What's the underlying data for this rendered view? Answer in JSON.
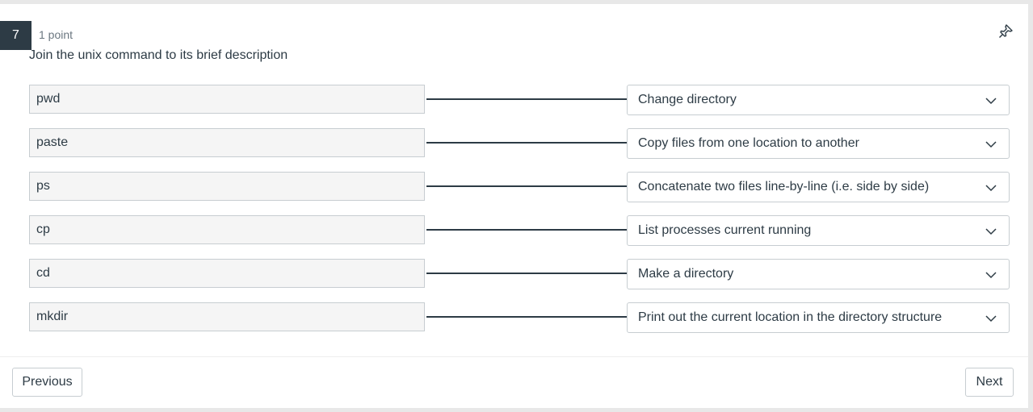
{
  "question": {
    "number": "7",
    "points": "1 point",
    "text": "Join the unix command to its brief description"
  },
  "pairs": [
    {
      "term": "pwd",
      "selected": "Change directory"
    },
    {
      "term": "paste",
      "selected": "Copy files from one location to another"
    },
    {
      "term": "ps",
      "selected": "Concatenate two files line-by-line (i.e. side by side)"
    },
    {
      "term": "cp",
      "selected": "List processes current running"
    },
    {
      "term": "cd",
      "selected": "Make a directory"
    },
    {
      "term": "mkdir",
      "selected": "Print out the current location in the directory structure"
    }
  ],
  "navigation": {
    "previous_label": "Previous",
    "next_label": "Next"
  },
  "icons": {
    "pin": "pushpin-icon",
    "dropdown": "chevron-down-icon"
  },
  "colors": {
    "accent_dark": "#2d3b45",
    "term_background": "#f5f5f5",
    "border": "#c7cdd1"
  }
}
